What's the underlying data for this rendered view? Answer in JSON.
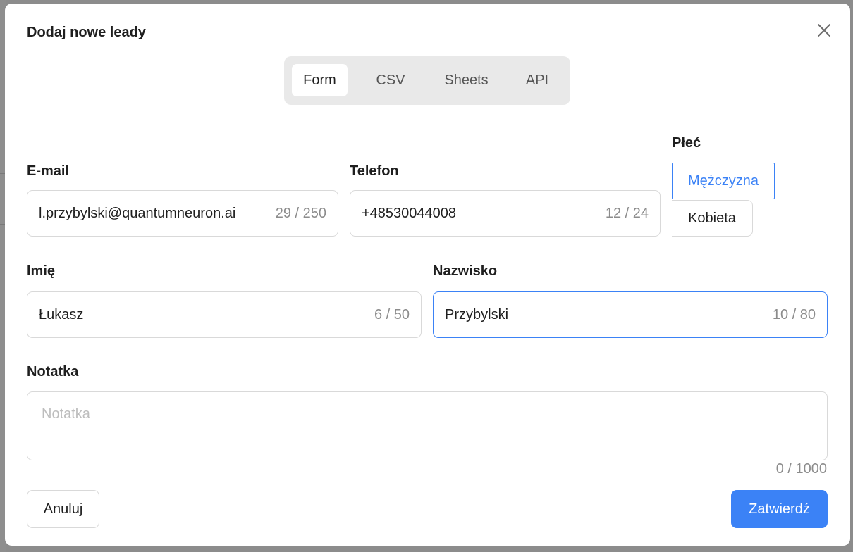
{
  "modal": {
    "title": "Dodaj nowe leady",
    "close_icon": "close-icon"
  },
  "tabs": [
    {
      "label": "Form",
      "active": true
    },
    {
      "label": "CSV",
      "active": false
    },
    {
      "label": "Sheets",
      "active": false
    },
    {
      "label": "API",
      "active": false
    }
  ],
  "form": {
    "email": {
      "label": "E-mail",
      "value": "l.przybylski@quantumneuron.ai",
      "count": "29 / 250"
    },
    "phone": {
      "label": "Telefon",
      "value": "+48530044008",
      "count": "12 / 24"
    },
    "gender": {
      "label": "Płeć",
      "options": [
        "Mężczyzna",
        "Kobieta"
      ],
      "selected": "Mężczyzna"
    },
    "first_name": {
      "label": "Imię",
      "value": "Łukasz",
      "count": "6 / 50"
    },
    "last_name": {
      "label": "Nazwisko",
      "value": "Przybylski",
      "count": "10 / 80"
    },
    "note": {
      "label": "Notatka",
      "placeholder": "Notatka",
      "count": "0 / 1000"
    }
  },
  "actions": {
    "cancel_label": "Anuluj",
    "submit_label": "Zatwierdź"
  },
  "colors": {
    "accent": "#3b82f6",
    "backdrop": "#8c8c8c"
  }
}
